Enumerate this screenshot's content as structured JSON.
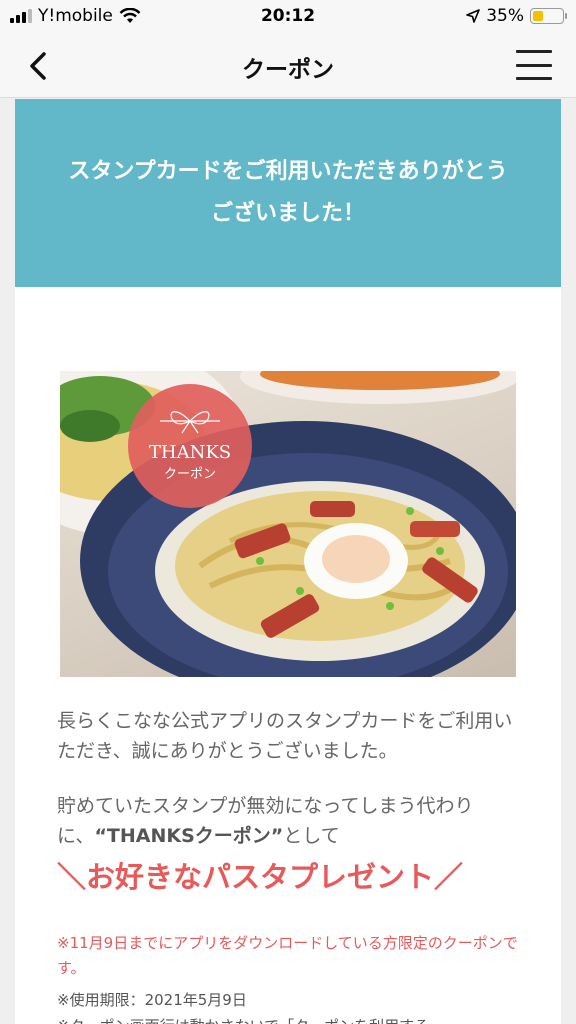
{
  "status_bar": {
    "carrier": "Y!mobile",
    "time": "20:12",
    "battery_percent": "35%",
    "battery_level": 0.35,
    "icons": [
      "signal-icon",
      "wifi-icon",
      "location-arrow-icon",
      "battery-icon"
    ]
  },
  "nav": {
    "title": "クーポン",
    "back_icon": "chevron-left-icon",
    "menu_icon": "hamburger-menu-icon"
  },
  "banner": {
    "line1": "スタンプカードをご利用いただきありがとう",
    "line2": "ございました！",
    "color": "#62b8c9"
  },
  "hero": {
    "badge_line1": "THANKS",
    "badge_line2": "クーポン",
    "badge_color": "#e0605c"
  },
  "message": {
    "paragraph1": "長らくこなな公式アプリのスタンプカードをご利用いただき、誠にありがとうございました。",
    "paragraph2_part1": "貯めていたスタンプが無効になってしまう代わりに、",
    "paragraph2_emphasis": "“THANKSクーポン”",
    "paragraph2_part2": "として",
    "highlight": "＼お好きなパスタプレゼント／",
    "highlight_color": "#e85a5a"
  },
  "notes": {
    "eligibility": "※11月9日までにアプリをダウンロードしている方限定のクーポンです。",
    "expiry": "※使用期限：2021年5月9日",
    "cut_off_line": "※クーポン画面行は動かさないで「クーポンを利用する"
  }
}
